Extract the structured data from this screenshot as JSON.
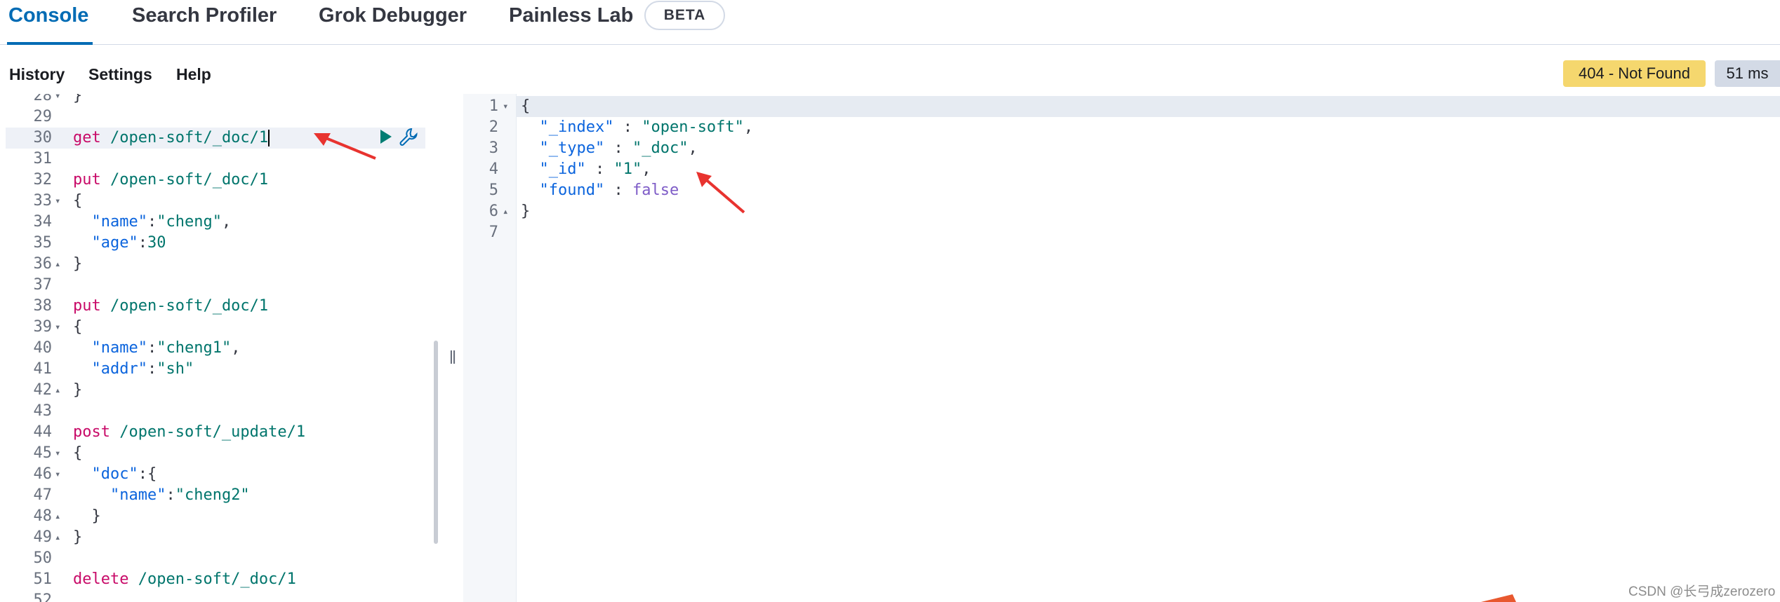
{
  "tabs": [
    {
      "label": "Console",
      "active": true
    },
    {
      "label": "Search Profiler"
    },
    {
      "label": "Grok Debugger"
    },
    {
      "label": "Painless Lab"
    }
  ],
  "beta_badge": "BETA",
  "menu": {
    "history": "History",
    "settings": "Settings",
    "help": "Help"
  },
  "status": {
    "code_text": "404 - Not Found",
    "time_text": "51 ms"
  },
  "editor": {
    "lines": [
      {
        "n": "28",
        "fold": "▾",
        "code": "}"
      },
      {
        "n": "29",
        "fold": "",
        "code": ""
      },
      {
        "n": "30",
        "fold": "",
        "code": "get /open-soft/_doc/1"
      },
      {
        "n": "31",
        "fold": "",
        "code": ""
      },
      {
        "n": "32",
        "fold": "",
        "code": "put /open-soft/_doc/1"
      },
      {
        "n": "33",
        "fold": "▾",
        "code": "{"
      },
      {
        "n": "34",
        "fold": "",
        "code": "  \"name\":\"cheng\","
      },
      {
        "n": "35",
        "fold": "",
        "code": "  \"age\":30"
      },
      {
        "n": "36",
        "fold": "▴",
        "code": "}"
      },
      {
        "n": "37",
        "fold": "",
        "code": ""
      },
      {
        "n": "38",
        "fold": "",
        "code": "put /open-soft/_doc/1"
      },
      {
        "n": "39",
        "fold": "▾",
        "code": "{"
      },
      {
        "n": "40",
        "fold": "",
        "code": "  \"name\":\"cheng1\","
      },
      {
        "n": "41",
        "fold": "",
        "code": "  \"addr\":\"sh\""
      },
      {
        "n": "42",
        "fold": "▴",
        "code": "}"
      },
      {
        "n": "43",
        "fold": "",
        "code": ""
      },
      {
        "n": "44",
        "fold": "",
        "code": "post /open-soft/_update/1"
      },
      {
        "n": "45",
        "fold": "▾",
        "code": "{"
      },
      {
        "n": "46",
        "fold": "▾",
        "code": "  \"doc\":{"
      },
      {
        "n": "47",
        "fold": "",
        "code": "    \"name\":\"cheng2\""
      },
      {
        "n": "48",
        "fold": "▴",
        "code": "  }"
      },
      {
        "n": "49",
        "fold": "▴",
        "code": "}"
      },
      {
        "n": "50",
        "fold": "",
        "code": ""
      },
      {
        "n": "51",
        "fold": "",
        "code": "delete /open-soft/_doc/1"
      },
      {
        "n": "52",
        "fold": "",
        "code": ""
      }
    ]
  },
  "output": {
    "lines": [
      {
        "n": "1",
        "fold": "▾",
        "code": "{"
      },
      {
        "n": "2",
        "fold": "",
        "code": "  \"_index\" : \"open-soft\","
      },
      {
        "n": "3",
        "fold": "",
        "code": "  \"_type\" : \"_doc\","
      },
      {
        "n": "4",
        "fold": "",
        "code": "  \"_id\" : \"1\","
      },
      {
        "n": "5",
        "fold": "",
        "code": "  \"found\" : false"
      },
      {
        "n": "6",
        "fold": "▴",
        "code": "}"
      },
      {
        "n": "7",
        "fold": "",
        "code": ""
      }
    ]
  },
  "icons": {
    "run": "play-icon",
    "wrench": "wrench-icon",
    "resizer": "drag-handle-icon"
  },
  "watermark": "CSDN @长弓成zerozero",
  "colors": {
    "accent": "#006bb4",
    "status_bg": "#f5d76e",
    "arrow": "#e8332f"
  }
}
